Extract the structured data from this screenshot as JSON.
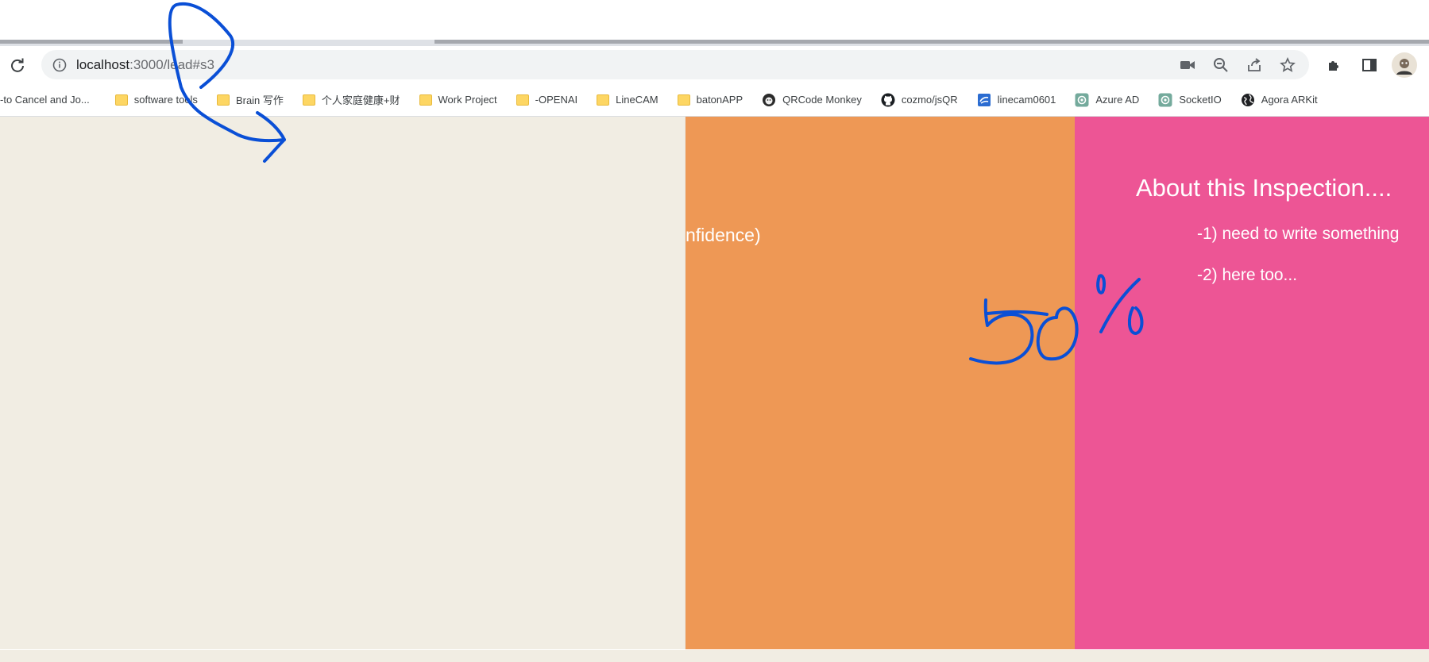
{
  "browser": {
    "url_host": "localhost",
    "url_rest": ":3000/lead#s3",
    "icons": {
      "reload": "reload-icon",
      "info": "info-icon",
      "camera": "camera-icon",
      "zoom": "zoom-out-icon",
      "share": "share-icon",
      "star": "star-icon",
      "extensions": "puzzle-icon",
      "sidepanel": "side-panel-icon",
      "avatar": "profile-avatar"
    }
  },
  "bookmarks": [
    {
      "label": "-to Cancel and Jo...",
      "icon": "none"
    },
    {
      "label": "software tools",
      "icon": "folder-icon"
    },
    {
      "label": "Brain 写作",
      "icon": "folder-icon"
    },
    {
      "label": "个人家庭健康+财",
      "icon": "folder-icon"
    },
    {
      "label": "Work Project",
      "icon": "folder-icon"
    },
    {
      "label": "-OPENAI",
      "icon": "folder-icon"
    },
    {
      "label": "LineCAM",
      "icon": "folder-icon"
    },
    {
      "label": "batonAPP",
      "icon": "folder-icon"
    },
    {
      "label": "QRCode Monkey",
      "icon": "monkey-icon"
    },
    {
      "label": "cozmo/jsQR",
      "icon": "github-icon"
    },
    {
      "label": "linecam0601",
      "icon": "app-icon"
    },
    {
      "label": "Azure AD",
      "icon": "openai-icon"
    },
    {
      "label": "SocketIO",
      "icon": "openai-icon"
    },
    {
      "label": "Agora ARKit",
      "icon": "globe-icon"
    }
  ],
  "page": {
    "orange_panel_text": "nfidence)",
    "pink_panel_title": "About this Inspection....",
    "pink_panel_lines": [
      "-1) need to write something",
      "-2) here too..."
    ]
  },
  "annotation": {
    "handwritten_text": "50%",
    "stroke_color": "#0a4fd6"
  },
  "colors": {
    "cream": "#f1ede3",
    "orange": "#ee9855",
    "pink": "#ed5595"
  }
}
